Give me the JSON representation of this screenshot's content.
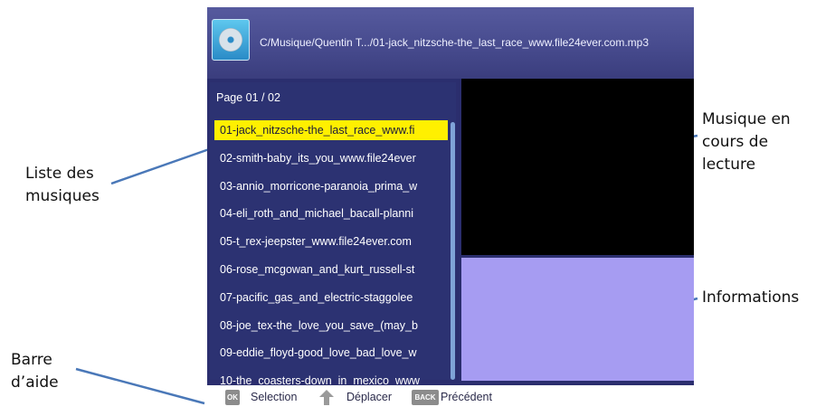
{
  "annotations": {
    "playlist": [
      "Liste des",
      "musiques"
    ],
    "now_playing": [
      "Musique en",
      "cours de",
      "lecture"
    ],
    "info": [
      "Informations"
    ],
    "help_bar": [
      "Barre",
      "d’aide"
    ]
  },
  "header": {
    "path": "C/Musique/Quentin T.../01-jack_nitzsche-the_last_race_www.file24ever.com.mp3",
    "icon": "music-disc-icon"
  },
  "playlist": {
    "page_label": "Page  01 / 02",
    "tracks": [
      "01-jack_nitzsche-the_last_race_www.fi",
      "02-smith-baby_its_you_www.file24ever",
      "03-annio_morricone-paranoia_prima_w",
      "04-eli_roth_and_michael_bacall-planni",
      "05-t_rex-jeepster_www.file24ever.com",
      "06-rose_mcgowan_and_kurt_russell-st",
      "07-pacific_gas_and_electric-staggolee",
      "08-joe_tex-the_love_you_save_(may_b",
      "09-eddie_floyd-good_love_bad_love_w",
      "10-the_coasters-down_in_mexico_www"
    ],
    "selected_index": 0
  },
  "help_bar": {
    "ok_key": "OK",
    "ok_label": "Selection",
    "move_label": "Déplacer",
    "back_key": "BACK",
    "back_label": "Précédent"
  },
  "colors": {
    "screen_bg": "#2b2e6e",
    "selected": "#fff000",
    "info_panel": "#a69cf2",
    "video": "#000000",
    "annotation_line": "#4a78b8"
  }
}
